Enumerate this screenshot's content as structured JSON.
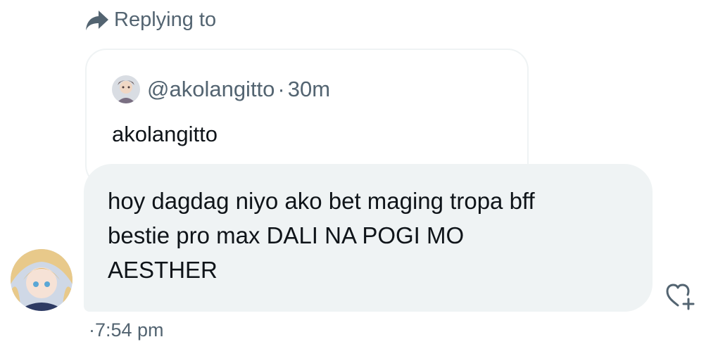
{
  "reply_header": {
    "label": "Replying to",
    "icon": "reply-arrow-icon"
  },
  "quoted_message": {
    "handle": "@akolangitto",
    "separator": "·",
    "time": "30m",
    "text": "akolangitto",
    "avatar_icon": "user-avatar"
  },
  "message": {
    "line1": "hoy dagdag niyo ako bet maging tropa bff",
    "line2": "bestie pro max DALI NA POGI MO",
    "line3": "AESTHER",
    "timestamp": "·7:54 pm"
  },
  "actions": {
    "react_icon": "heart-plus-icon"
  },
  "colors": {
    "secondary_text": "#536471",
    "primary_text": "#0f1419",
    "bubble_bg": "#eff3f4",
    "border": "#eff3f4"
  }
}
